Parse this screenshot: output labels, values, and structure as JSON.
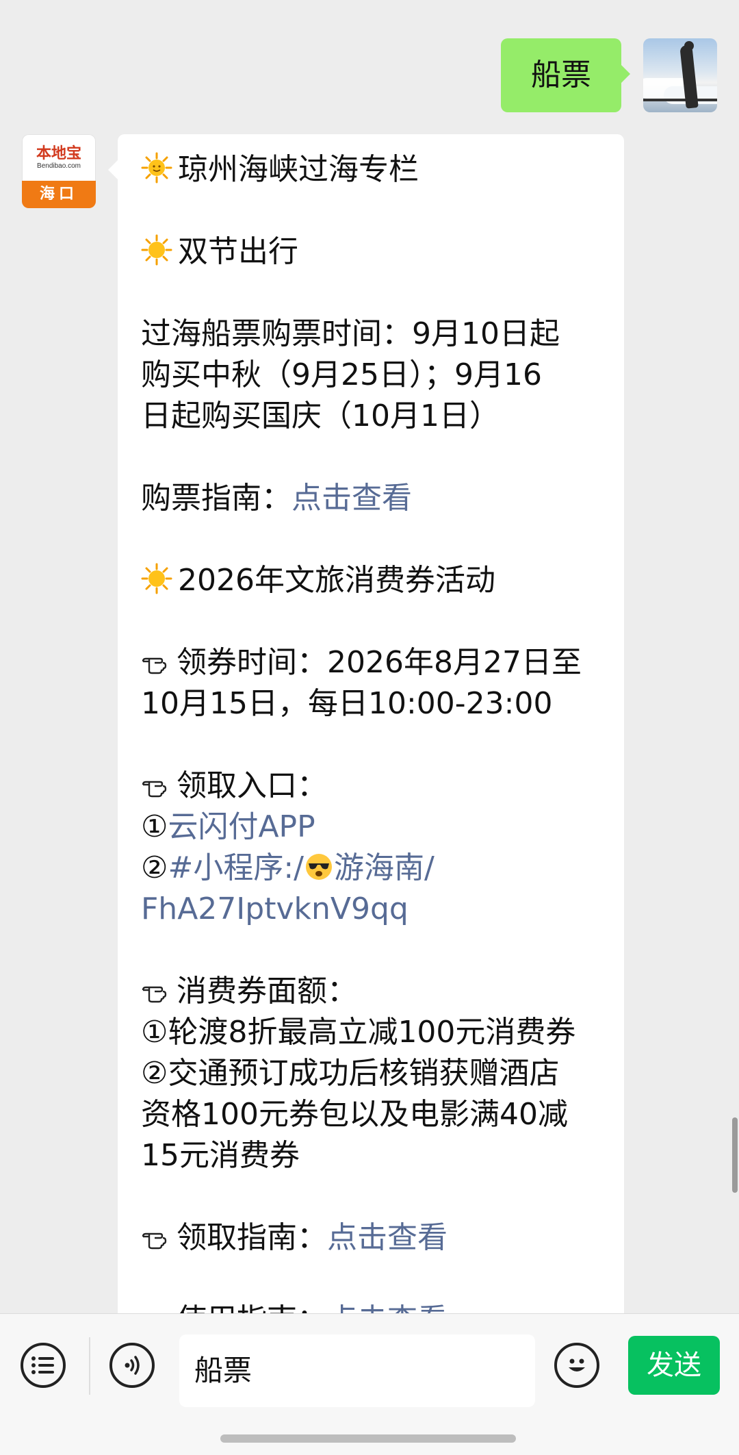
{
  "outgoing": {
    "text": "船票"
  },
  "bot": {
    "brand": "本地宝",
    "domain": "Bendibao.com",
    "city": "海口"
  },
  "article": {
    "title": "琼州海峡过海专栏",
    "section1_title": "双节出行",
    "ferry_time_l1": "过海船票购票时间：9月10日起",
    "ferry_time_l2": "购买中秋（9月25日）；9月16",
    "ferry_time_l3": "日起购买国庆（10月1日）",
    "guide_label": "购票指南：",
    "guide_link": "点击查看",
    "section2_title": "2026年文旅消费券活动",
    "claim_time_l1": "领券时间：2026年8月27日至",
    "claim_time_l2": "10月15日，每日10:00-23:00",
    "entry_label": "领取入口：",
    "entry1_num": "①",
    "entry1_link": "云闪付APP",
    "entry2_num": "②",
    "entry2_link_a": "#小程序:/",
    "entry2_link_b": "游海南/",
    "entry2_link_c": "FhA27IptvknV9qq",
    "amount_label": "消费券面额：",
    "amount1": "①轮渡8折最高立减100元消费券",
    "amount2_l1": "②交通预订成功后核销获赠酒店",
    "amount2_l2": "资格100元券包以及电影满40减",
    "amount2_l3": "15元消费券",
    "claim_guide_label": "领取指南：",
    "claim_guide_link": "点击查看",
    "use_guide_label": "使用指南：",
    "use_guide_link": "点击查看"
  },
  "input": {
    "value": "船票",
    "send_label": "发送"
  },
  "icons": {
    "sun": "sun-icon",
    "pointing_hand": "pointing-hand-icon",
    "face": "sunglasses-face-icon",
    "menu": "menu-list-icon",
    "voice": "voice-icon",
    "emoji": "emoji-icon"
  },
  "colors": {
    "outgoing_bubble": "#95ec69",
    "link": "#576b95",
    "send_button": "#07c160",
    "brand_orange": "#f07a14"
  }
}
